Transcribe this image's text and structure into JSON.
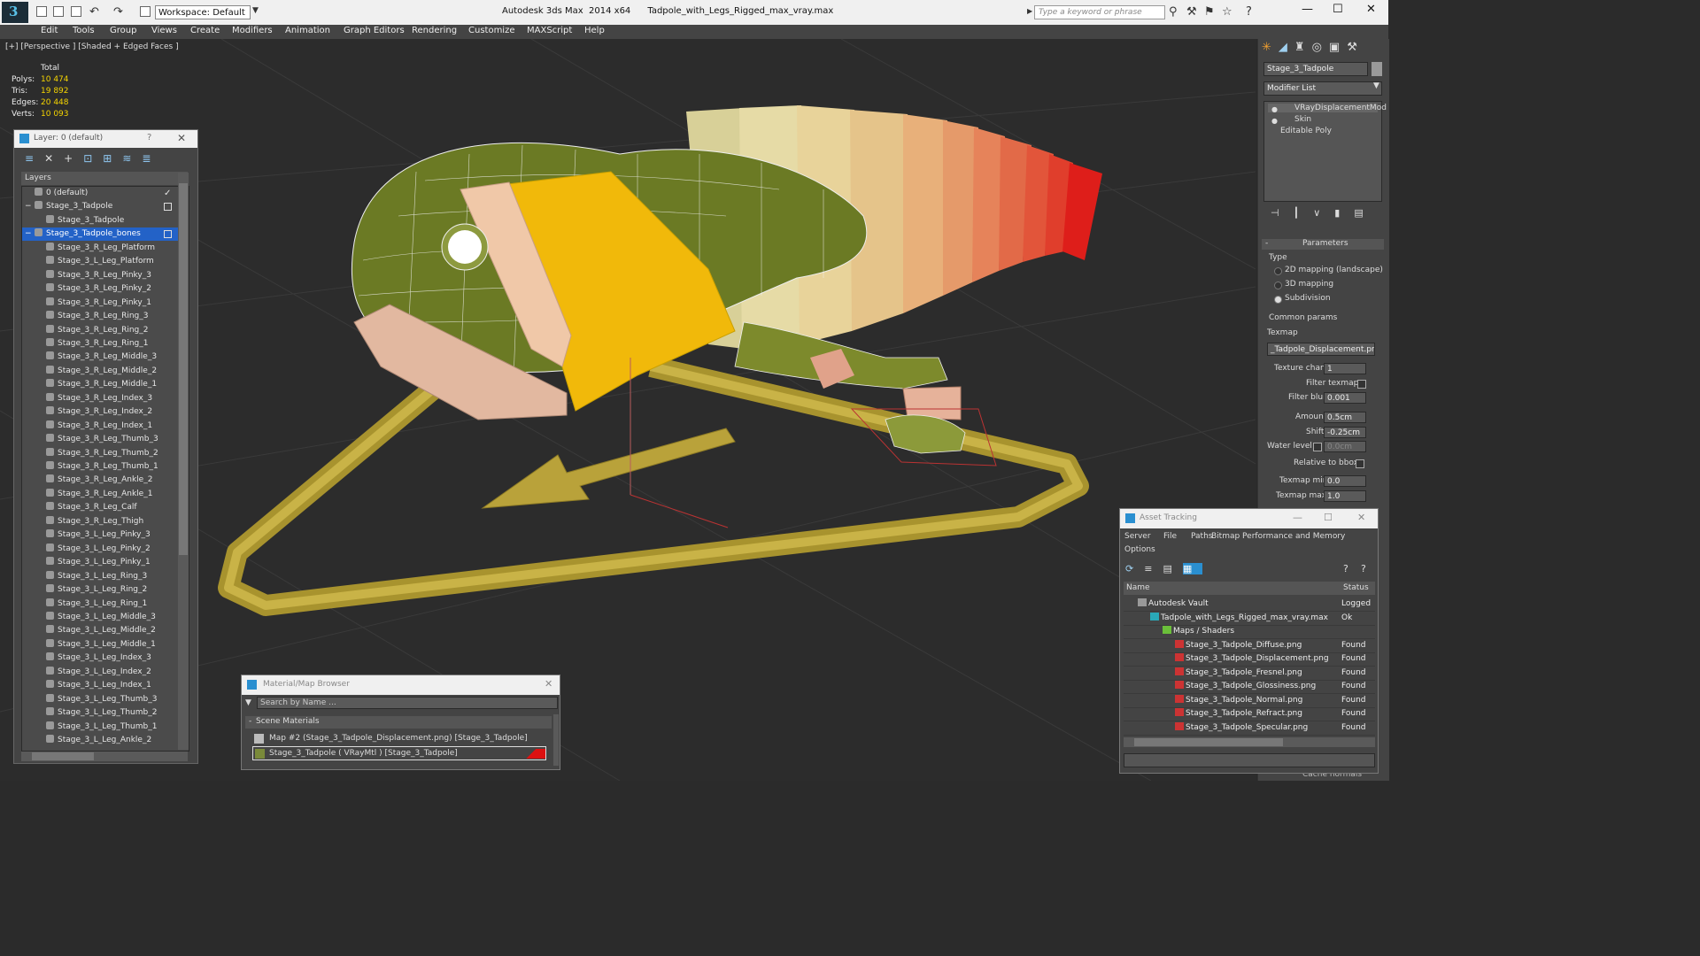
{
  "titlebar": {
    "workspace": "Workspace: Default",
    "app_title": "Autodesk 3ds Max  2014 x64      Tadpole_with_Legs_Rigged_max_vray.max",
    "search_placeholder": "Type a keyword or phrase"
  },
  "menu": [
    "Edit",
    "Tools",
    "Group",
    "Views",
    "Create",
    "Modifiers",
    "Animation",
    "Graph Editors",
    "Rendering",
    "Customize",
    "MAXScript",
    "Help"
  ],
  "viewport": {
    "label": "[+] [Perspective ] [Shaded + Edged Faces ]",
    "stats": {
      "header": "Total",
      "rows": [
        {
          "label": "Polys:",
          "value": "10 474"
        },
        {
          "label": "Tris:",
          "value": "19 892"
        },
        {
          "label": "Edges:",
          "value": "20 448"
        },
        {
          "label": "Verts:",
          "value": "10 093"
        }
      ]
    }
  },
  "layer_dialog": {
    "title": "Layer: 0 (default)",
    "help": "?",
    "column": "Layers",
    "rows": [
      {
        "label": "0 (default)",
        "indent": 1
      },
      {
        "label": "Stage_3_Tadpole",
        "indent": 1
      },
      {
        "label": "Stage_3_Tadpole",
        "indent": 2
      },
      {
        "label": "Stage_3_Tadpole_bones",
        "indent": 1
      },
      {
        "label": "Stage_3_R_Leg_Platform",
        "indent": 2
      },
      {
        "label": "Stage_3_L_Leg_Platform",
        "indent": 2
      },
      {
        "label": "Stage_3_R_Leg_Pinky_3",
        "indent": 2
      },
      {
        "label": "Stage_3_R_Leg_Pinky_2",
        "indent": 2
      },
      {
        "label": "Stage_3_R_Leg_Pinky_1",
        "indent": 2
      },
      {
        "label": "Stage_3_R_Leg_Ring_3",
        "indent": 2
      },
      {
        "label": "Stage_3_R_Leg_Ring_2",
        "indent": 2
      },
      {
        "label": "Stage_3_R_Leg_Ring_1",
        "indent": 2
      },
      {
        "label": "Stage_3_R_Leg_Middle_3",
        "indent": 2
      },
      {
        "label": "Stage_3_R_Leg_Middle_2",
        "indent": 2
      },
      {
        "label": "Stage_3_R_Leg_Middle_1",
        "indent": 2
      },
      {
        "label": "Stage_3_R_Leg_Index_3",
        "indent": 2
      },
      {
        "label": "Stage_3_R_Leg_Index_2",
        "indent": 2
      },
      {
        "label": "Stage_3_R_Leg_Index_1",
        "indent": 2
      },
      {
        "label": "Stage_3_R_Leg_Thumb_3",
        "indent": 2
      },
      {
        "label": "Stage_3_R_Leg_Thumb_2",
        "indent": 2
      },
      {
        "label": "Stage_3_R_Leg_Thumb_1",
        "indent": 2
      },
      {
        "label": "Stage_3_R_Leg_Ankle_2",
        "indent": 2
      },
      {
        "label": "Stage_3_R_Leg_Ankle_1",
        "indent": 2
      },
      {
        "label": "Stage_3_R_Leg_Calf",
        "indent": 2
      },
      {
        "label": "Stage_3_R_Leg_Thigh",
        "indent": 2
      },
      {
        "label": "Stage_3_L_Leg_Pinky_3",
        "indent": 2
      },
      {
        "label": "Stage_3_L_Leg_Pinky_2",
        "indent": 2
      },
      {
        "label": "Stage_3_L_Leg_Pinky_1",
        "indent": 2
      },
      {
        "label": "Stage_3_L_Leg_Ring_3",
        "indent": 2
      },
      {
        "label": "Stage_3_L_Leg_Ring_2",
        "indent": 2
      },
      {
        "label": "Stage_3_L_Leg_Ring_1",
        "indent": 2
      },
      {
        "label": "Stage_3_L_Leg_Middle_3",
        "indent": 2
      },
      {
        "label": "Stage_3_L_Leg_Middle_2",
        "indent": 2
      },
      {
        "label": "Stage_3_L_Leg_Middle_1",
        "indent": 2
      },
      {
        "label": "Stage_3_L_Leg_Index_3",
        "indent": 2
      },
      {
        "label": "Stage_3_L_Leg_Index_2",
        "indent": 2
      },
      {
        "label": "Stage_3_L_Leg_Index_1",
        "indent": 2
      },
      {
        "label": "Stage_3_L_Leg_Thumb_3",
        "indent": 2
      },
      {
        "label": "Stage_3_L_Leg_Thumb_2",
        "indent": 2
      },
      {
        "label": "Stage_3_L_Leg_Thumb_1",
        "indent": 2
      },
      {
        "label": "Stage_3_L_Leg_Ankle_2",
        "indent": 2
      }
    ],
    "selected_index": 3
  },
  "command_panel": {
    "object_name": "Stage_3_Tadpole",
    "modifier_list": "Modifier List",
    "stack": [
      "VRayDisplacementMod",
      "Skin",
      "Editable Poly"
    ],
    "rollout": "Parameters",
    "type_label": "Type",
    "type_options": [
      "2D mapping (landscape)",
      "3D mapping",
      "Subdivision"
    ],
    "type_selected": 2,
    "common_params": "Common params",
    "texmap_label": "Texmap",
    "texmap_value": "_Tadpole_Displacement.png)",
    "texture_chan_label": "Texture chan",
    "texture_chan_value": "1",
    "filter_texmap_label": "Filter texmap",
    "filter_blur_label": "Filter blur",
    "filter_blur_value": "0.001",
    "amount_label": "Amount",
    "amount_value": "0.5cm",
    "shift_label": "Shift",
    "shift_value": "-0.25cm",
    "water_level_label": "Water level",
    "water_level_value": "0.0cm",
    "relative_bbox_label": "Relative to bbox",
    "texmap_min_label": "Texmap min",
    "texmap_min_value": "0.0",
    "texmap_max_label": "Texmap max",
    "texmap_max_value": "1.0",
    "cache_normals_label": "Cache normals"
  },
  "asset_tracking": {
    "title": "Asset Tracking",
    "menu": [
      "Server",
      "File",
      "Paths",
      "Bitmap Performance and Memory",
      "Options"
    ],
    "col_name": "Name",
    "col_status": "Status",
    "rows": [
      {
        "name": "Autodesk Vault",
        "status": "Logged",
        "indent": 1,
        "kind": "vault"
      },
      {
        "name": "Tadpole_with_Legs_Rigged_max_vray.max",
        "status": "Ok",
        "indent": 2,
        "kind": "max"
      },
      {
        "name": "Maps / Shaders",
        "status": "",
        "indent": 3,
        "kind": "folder"
      },
      {
        "name": "Stage_3_Tadpole_Diffuse.png",
        "status": "Found",
        "indent": 4,
        "kind": "png"
      },
      {
        "name": "Stage_3_Tadpole_Displacement.png",
        "status": "Found",
        "indent": 4,
        "kind": "png"
      },
      {
        "name": "Stage_3_Tadpole_Fresnel.png",
        "status": "Found",
        "indent": 4,
        "kind": "png"
      },
      {
        "name": "Stage_3_Tadpole_Glossiness.png",
        "status": "Found",
        "indent": 4,
        "kind": "png"
      },
      {
        "name": "Stage_3_Tadpole_Normal.png",
        "status": "Found",
        "indent": 4,
        "kind": "png"
      },
      {
        "name": "Stage_3_Tadpole_Refract.png",
        "status": "Found",
        "indent": 4,
        "kind": "png"
      },
      {
        "name": "Stage_3_Tadpole_Specular.png",
        "status": "Found",
        "indent": 4,
        "kind": "png"
      }
    ]
  },
  "material_browser": {
    "title": "Material/Map Browser",
    "search_placeholder": "Search by Name ...",
    "group": "Scene Materials",
    "items": [
      "Map #2 (Stage_3_Tadpole_Displacement.png) [Stage_3_Tadpole]",
      "Stage_3_Tadpole  ( VRayMtl )  [Stage_3_Tadpole]"
    ]
  }
}
